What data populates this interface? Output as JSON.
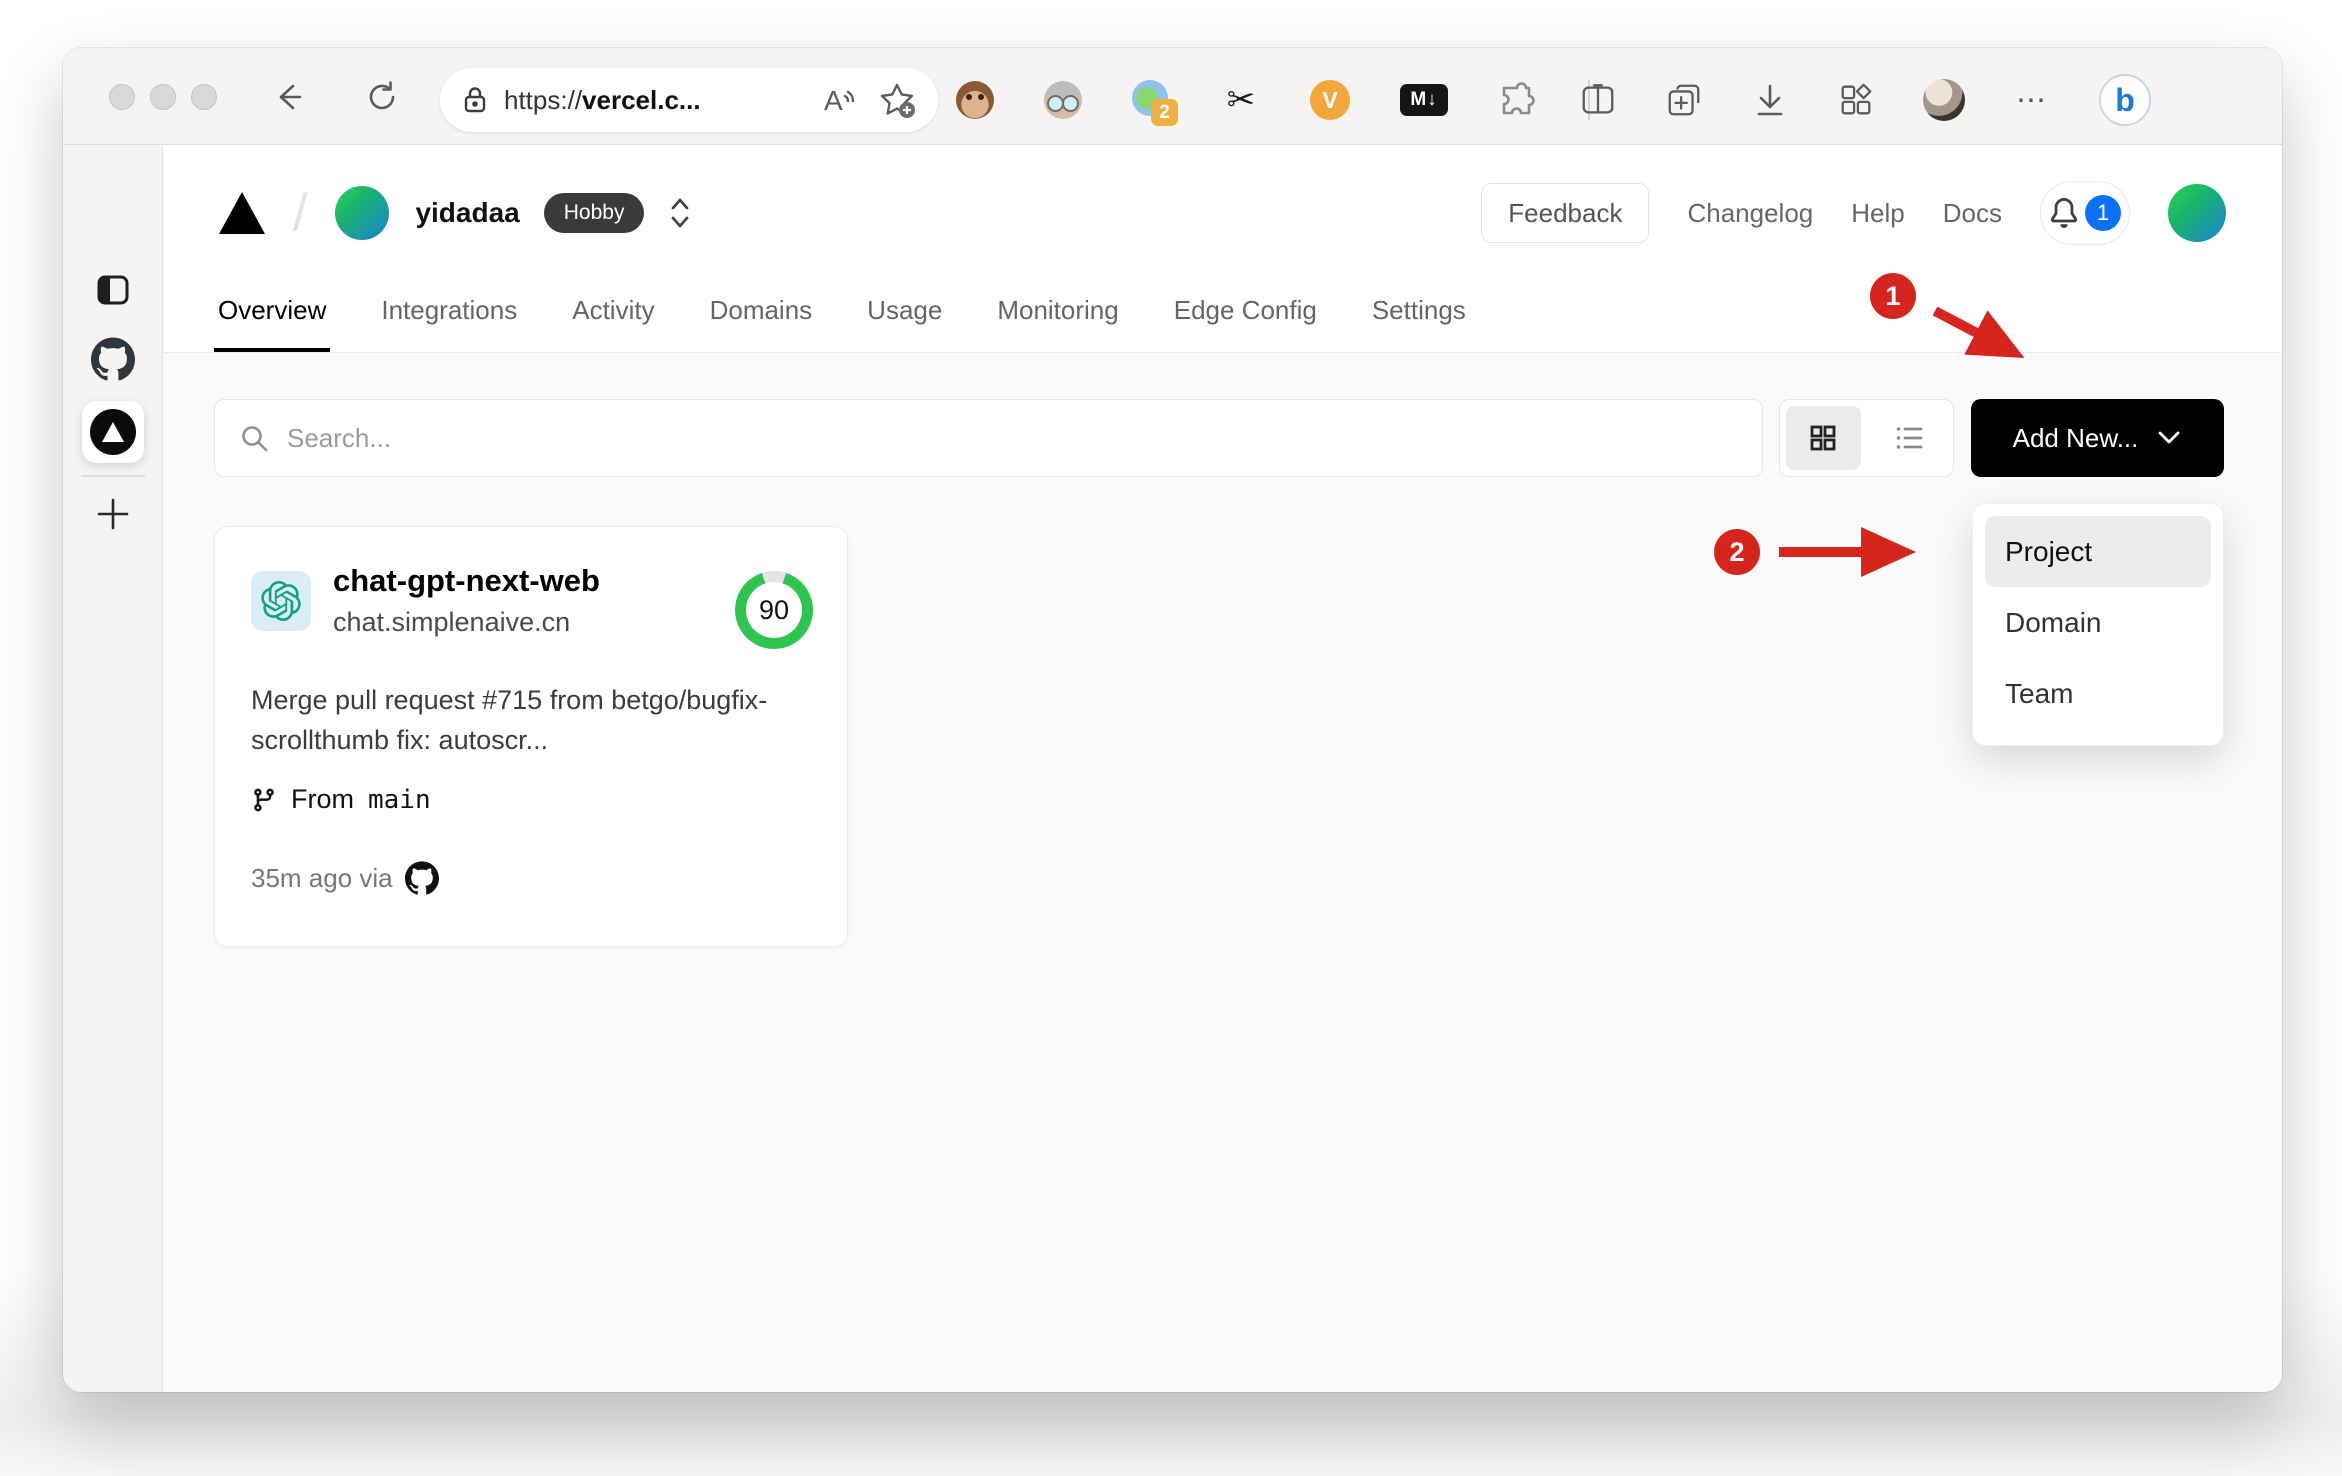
{
  "browser": {
    "url_prefix": "https://",
    "url_host": "vercel.c...",
    "reader_label": "A",
    "ext_badge": "2",
    "v_ext_label": "V",
    "markdown_ext_label": "M↓",
    "more_label": "⋯",
    "bing_label": "b"
  },
  "header": {
    "team_name": "yidadaa",
    "plan_badge": "Hobby",
    "feedback_label": "Feedback",
    "nav": [
      {
        "label": "Changelog"
      },
      {
        "label": "Help"
      },
      {
        "label": "Docs"
      }
    ],
    "notification_count": "1"
  },
  "tabs": [
    {
      "label": "Overview",
      "active": true
    },
    {
      "label": "Integrations",
      "active": false
    },
    {
      "label": "Activity",
      "active": false
    },
    {
      "label": "Domains",
      "active": false
    },
    {
      "label": "Usage",
      "active": false
    },
    {
      "label": "Monitoring",
      "active": false
    },
    {
      "label": "Edge Config",
      "active": false
    },
    {
      "label": "Settings",
      "active": false
    }
  ],
  "toolbar": {
    "search_placeholder": "Search...",
    "add_new_label": "Add New..."
  },
  "project_card": {
    "name": "chat-gpt-next-web",
    "domain": "chat.simplenaive.cn",
    "score": "90",
    "commit_message": "Merge pull request #715 from betgo/bugfix-scrollthumb fix: autoscr...",
    "branch_prefix": "From",
    "branch_name": "main",
    "deploy_meta": "35m ago via"
  },
  "add_new_menu": {
    "items": [
      {
        "label": "Project",
        "highlighted": true
      },
      {
        "label": "Domain",
        "highlighted": false
      },
      {
        "label": "Team",
        "highlighted": false
      }
    ]
  },
  "annotations": {
    "step1": "1",
    "step2": "2"
  },
  "colors": {
    "annotation_red": "#d6241e",
    "score_green": "#2fc34f",
    "notification_blue": "#0b72f5",
    "button_black": "#000000",
    "plan_badge_bg": "#3a3a3a",
    "content_bg": "#fafafa"
  }
}
